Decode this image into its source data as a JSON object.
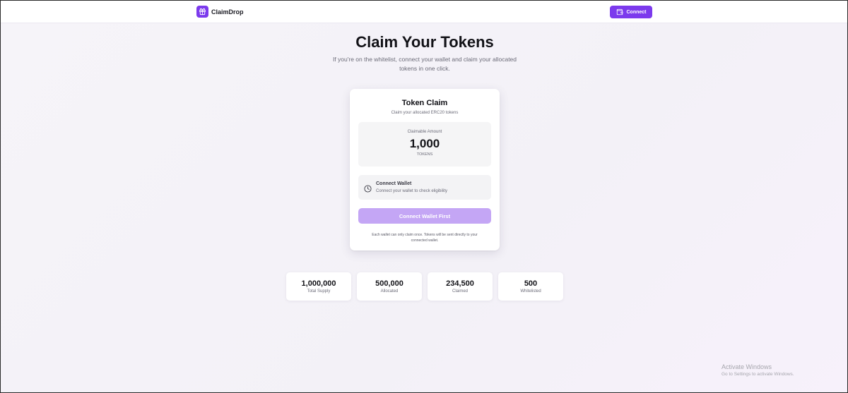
{
  "header": {
    "brand_name": "ClaimDrop",
    "connect_label": "Connect"
  },
  "hero": {
    "title": "Claim Your Tokens",
    "subtitle_line1": "If you're on the whitelist, connect your wallet and claim your allocated",
    "subtitle_line2": "tokens in one click."
  },
  "claim_card": {
    "title": "Token Claim",
    "subtitle": "Claim your allocated ERC20 tokens",
    "amount_label": "Claimable Amount",
    "amount_value": "1,000",
    "amount_unit": "TOKENS",
    "status_title": "Connect Wallet",
    "status_text": "Connect your wallet to check eligibility",
    "claim_button_label": "Connect Wallet First",
    "note_line1": "Each wallet can only claim once. Tokens will be sent directly to your",
    "note_line2": "connected wallet."
  },
  "stats": [
    {
      "value": "1,000,000",
      "label": "Total Supply"
    },
    {
      "value": "500,000",
      "label": "Allocated"
    },
    {
      "value": "234,500",
      "label": "Claimed"
    },
    {
      "value": "500",
      "label": "Whitelisted"
    }
  ],
  "watermark": {
    "title": "Activate Windows",
    "subtitle": "Go to Settings to activate Windows."
  },
  "icons": {
    "brand": "gift-icon",
    "connect": "wallet-icon",
    "status": "clock-icon"
  },
  "colors": {
    "accent": "#7c3aed",
    "accent_disabled": "#c4a6f5"
  }
}
